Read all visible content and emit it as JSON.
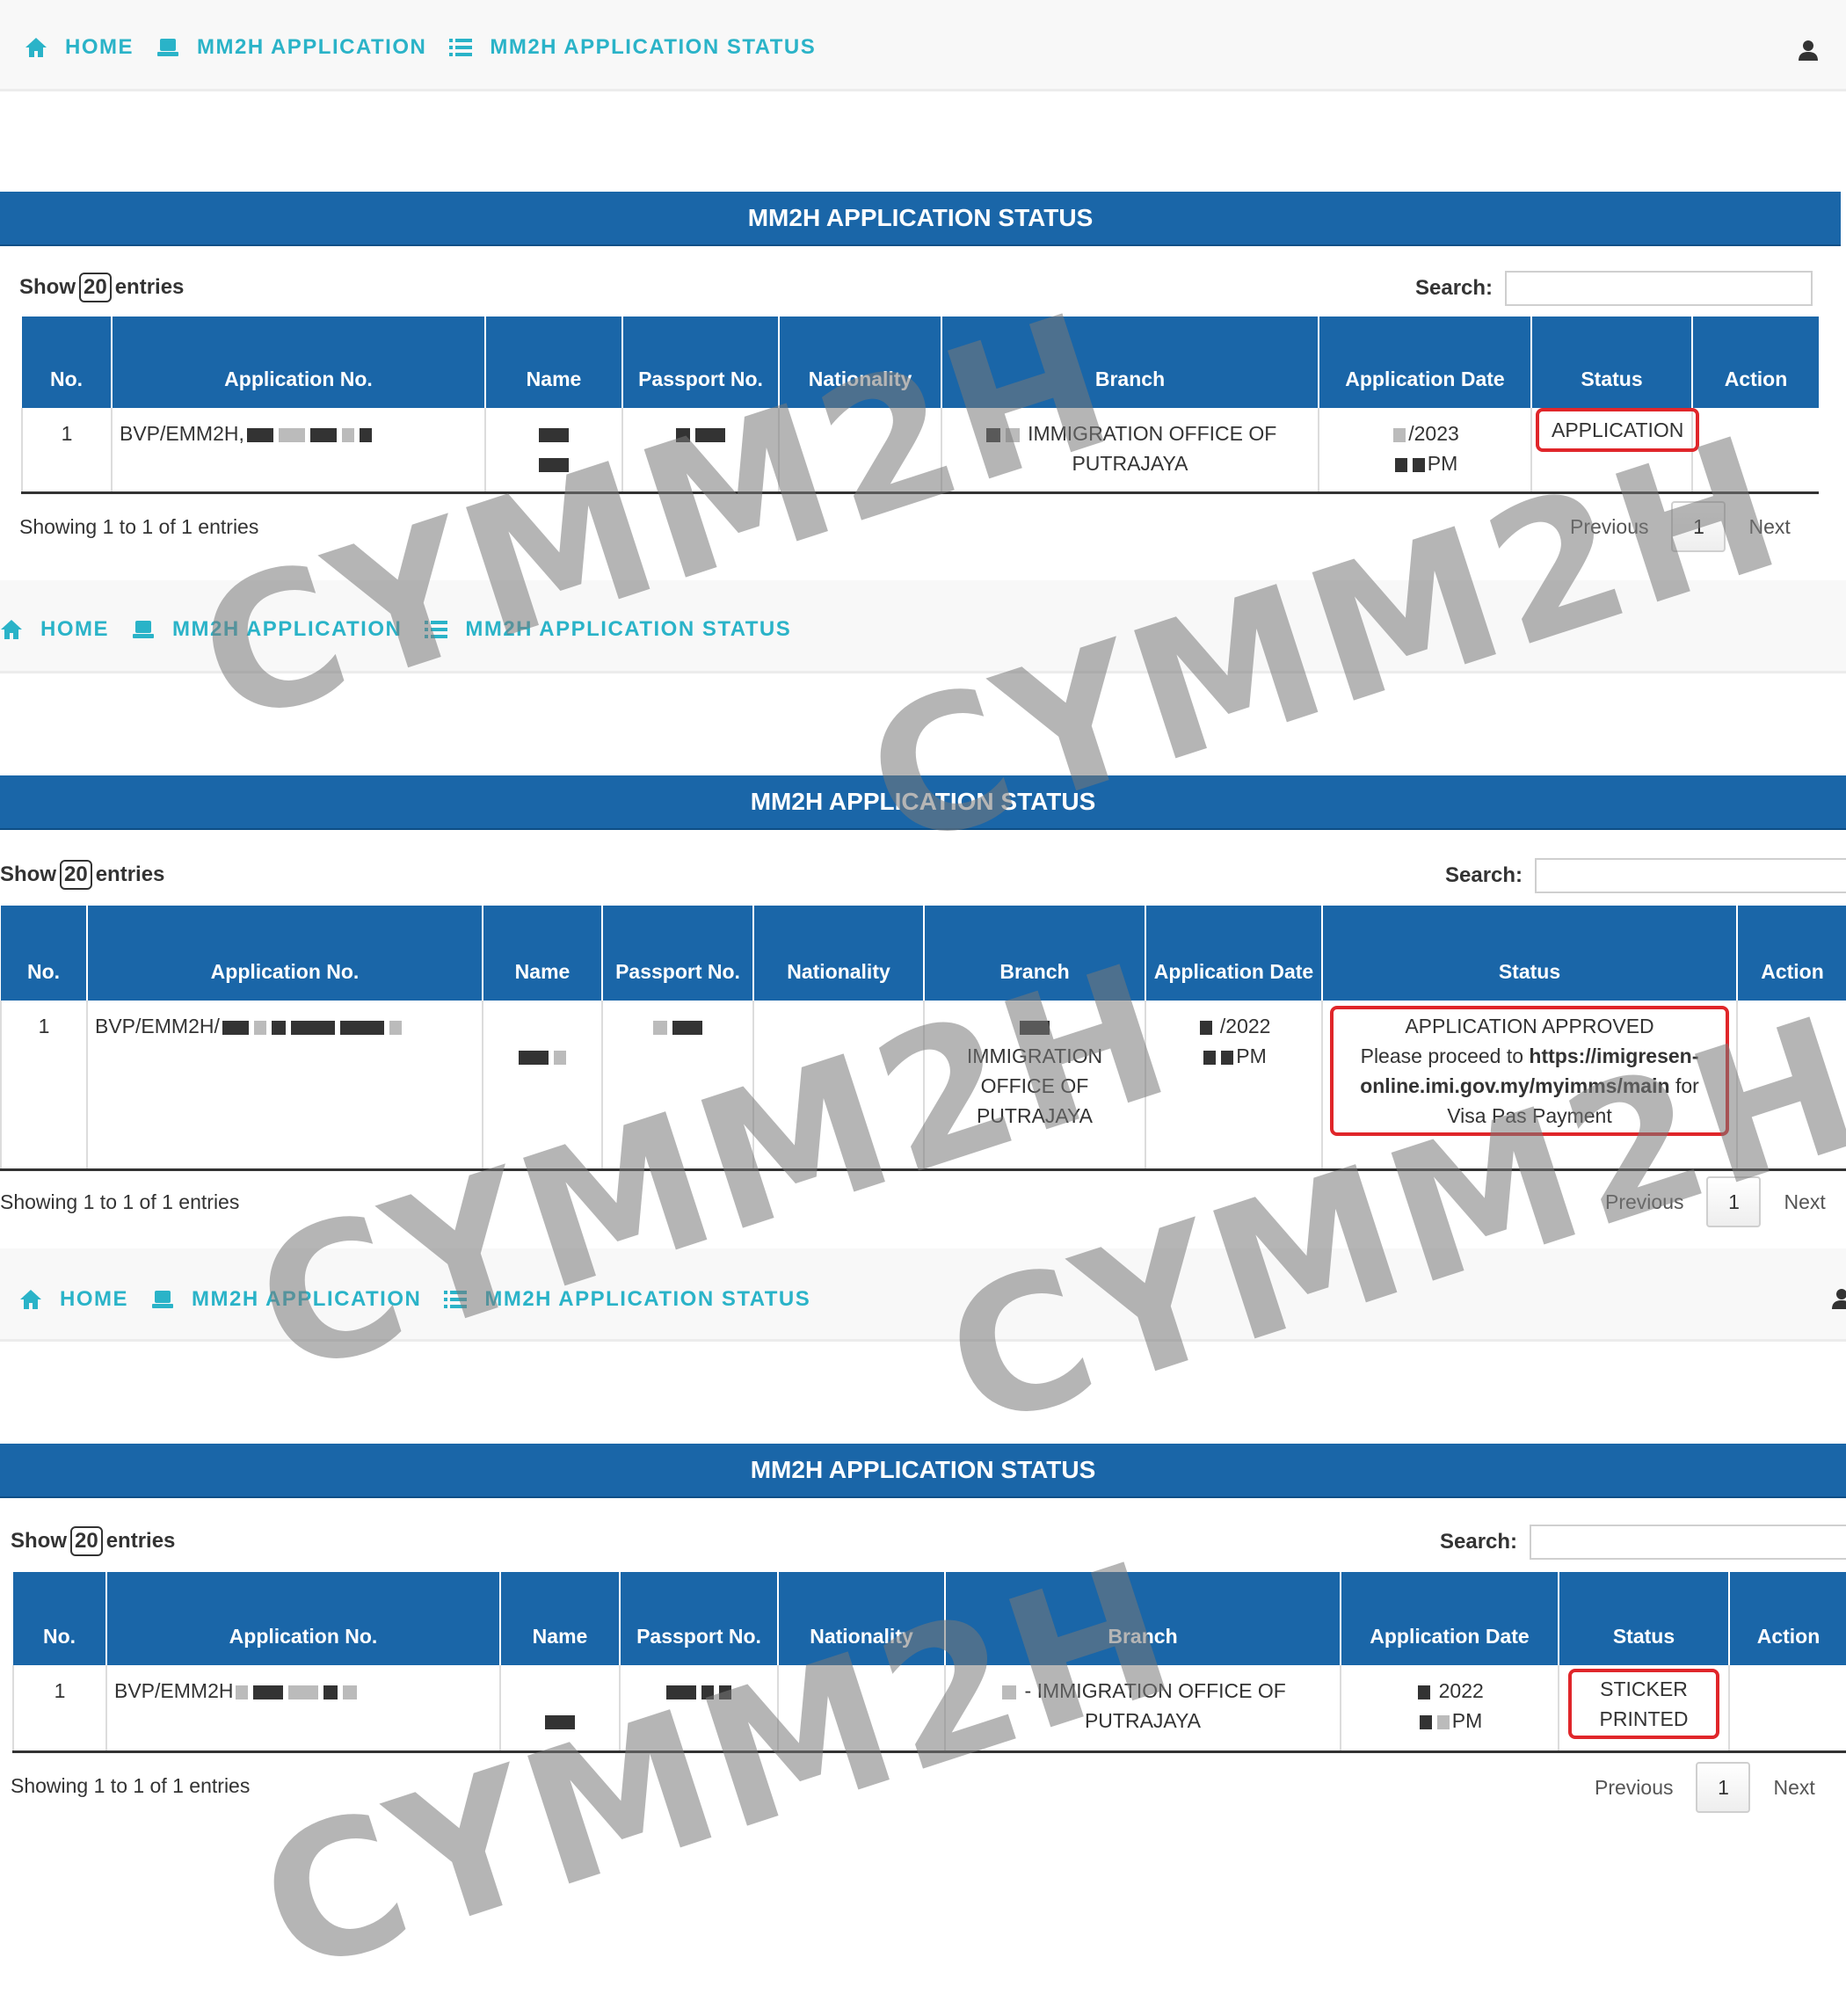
{
  "nav": {
    "home": "HOME",
    "application": "MM2H APPLICATION",
    "status": "MM2H APPLICATION STATUS"
  },
  "colors": {
    "accent": "#2ab3c8",
    "header": "#1a66a8",
    "highlight": "#e0262a"
  },
  "icons": {
    "home": "home-icon",
    "application": "laptop-icon",
    "status": "list-icon",
    "user": "user-icon"
  },
  "common": {
    "show": "Show",
    "entries_count": "20",
    "entries": "entries",
    "search_label": "Search:",
    "previous": "Previous",
    "page": "1",
    "next": "Next",
    "showing": "Showing 1 to 1 of 1 entries"
  },
  "panels": [
    {
      "title": "MM2H APPLICATION STATUS",
      "columns": [
        "No.",
        "Application No.",
        "Name",
        "Passport No.",
        "Nationality",
        "Branch",
        "Application Date",
        "Status",
        "Action"
      ],
      "row": {
        "no": "1",
        "app_no": "BVP/EMM2H,",
        "branch": "IMMIGRATION OFFICE OF PUTRAJAYA",
        "date_line1": "/2023",
        "date_line2": "PM",
        "status": "APPLICATION"
      }
    },
    {
      "title": "MM2H APPLICATION STATUS",
      "columns": [
        "No.",
        "Application No.",
        "Name",
        "Passport No.",
        "Nationality",
        "Branch",
        "Application Date",
        "Status",
        "Action"
      ],
      "row": {
        "no": "1",
        "app_no": "BVP/EMM2H/",
        "branch": "IMMIGRATION OFFICE OF PUTRAJAYA",
        "date_line1": "/2022",
        "date_line2": "PM",
        "status_line1": "APPLICATION APPROVED",
        "status_pre": "Please proceed to",
        "status_link": "https://imigresen-online.imi.gov.my/myimms/main",
        "status_post": "for Visa Pas Payment"
      }
    },
    {
      "title": "MM2H APPLICATION STATUS",
      "columns": [
        "No.",
        "Application No.",
        "Name",
        "Passport No.",
        "Nationality",
        "Branch",
        "Application Date",
        "Status",
        "Action"
      ],
      "row": {
        "no": "1",
        "app_no": "BVP/EMM2H",
        "branch": "- IMMIGRATION OFFICE OF PUTRAJAYA",
        "date_line1": "2022",
        "date_line2": "PM",
        "status": "STICKER PRINTED"
      }
    }
  ],
  "watermark": "CYMM2H"
}
